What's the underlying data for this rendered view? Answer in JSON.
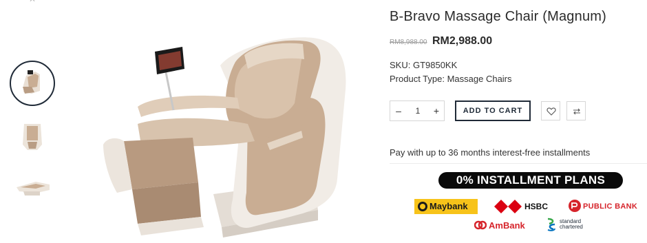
{
  "product": {
    "title": "B-Bravo Massage Chair (Magnum)",
    "price_old": "RM8,988.00",
    "price_new": "RM2,988.00",
    "sku_label": "SKU: GT9850KK",
    "type_label": "Product Type: Massage Chairs"
  },
  "cart": {
    "minus": "–",
    "quantity": "1",
    "plus": "+",
    "add_to_cart": "ADD TO CART"
  },
  "installments": {
    "text": "Pay with up to 36 months interest-free installments",
    "banner": "0% INSTALLMENT PLANS",
    "banks": {
      "maybank": "Maybank",
      "hsbc": "HSBC",
      "publicbank": "PUBLIC BANK",
      "ambank": "AmBank",
      "scb": "standard chartered"
    }
  },
  "gallery": {
    "close_icon": "close-icon",
    "active_thumb": 1,
    "thumbs": [
      "chair-angle-thumb",
      "chair-front-thumb",
      "chair-reclined-thumb"
    ]
  },
  "colors": {
    "accent": "#1f2a37",
    "chair_beige": "#c9ad93",
    "chair_white": "#f1ece6",
    "bank_red": "#d6242b",
    "maybank_yellow": "#f7c31a"
  },
  "icons": {
    "wishlist": "heart-icon",
    "compare": "compare-arrows-icon"
  }
}
